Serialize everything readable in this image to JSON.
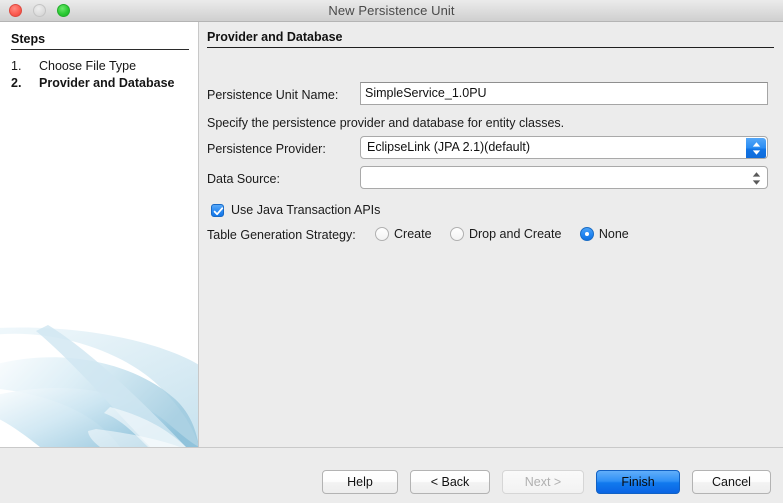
{
  "window": {
    "title": "New Persistence Unit",
    "traffic_lights": [
      {
        "name": "close",
        "color": "#fc5d52",
        "enabled": true
      },
      {
        "name": "minimize",
        "color": "#dcdcdc",
        "enabled": false
      },
      {
        "name": "maximize",
        "color": "#2ccb34",
        "enabled": true
      }
    ]
  },
  "sidebar": {
    "heading": "Steps",
    "steps": [
      {
        "number": "1.",
        "label": "Choose File Type",
        "current": false
      },
      {
        "number": "2.",
        "label": "Provider and Database",
        "current": true
      }
    ]
  },
  "main": {
    "panel_title": "Provider and Database",
    "unit_name_label": "Persistence Unit Name:",
    "unit_name_value": "SimpleService_1.0PU",
    "unit_name_placeholder": "",
    "description": "Specify the persistence provider and database for entity classes.",
    "provider_label": "Persistence Provider:",
    "provider_value": "EclipseLink (JPA 2.1)(default)",
    "data_source_label": "Data Source:",
    "data_source_value": "",
    "use_jta_label": "Use Java Transaction APIs",
    "use_jta_checked": true,
    "strategy_label": "Table Generation Strategy:",
    "strategy_options": [
      {
        "label": "Create",
        "selected": false
      },
      {
        "label": "Drop and Create",
        "selected": false
      },
      {
        "label": "None",
        "selected": true
      }
    ]
  },
  "footer": {
    "help": "Help",
    "back": "< Back",
    "next": "Next >",
    "finish": "Finish",
    "cancel": "Cancel",
    "next_enabled": false,
    "finish_default": true
  },
  "colors": {
    "accent_blue": "#2286f1",
    "window_bg": "#ececec",
    "sidebar_bg": "#ffffff",
    "swoosh_blue": "#a9d5e8"
  }
}
